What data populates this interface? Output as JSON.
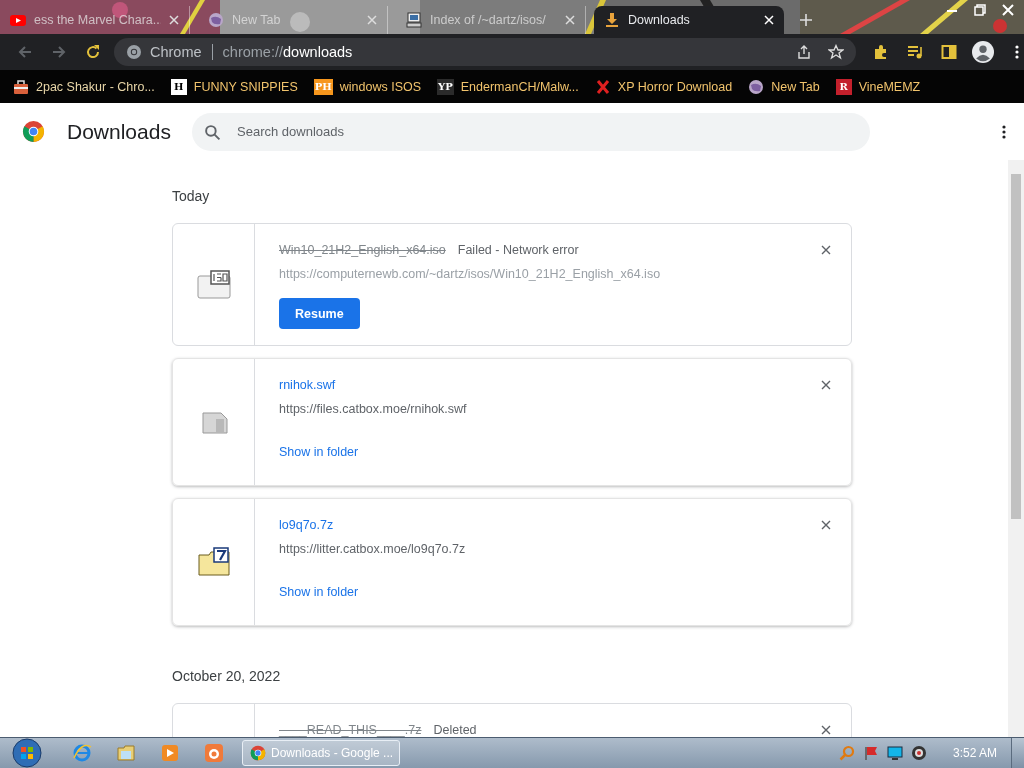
{
  "tabs": [
    {
      "title": "ess the Marvel Chara...",
      "selected": false
    },
    {
      "title": "New Tab",
      "selected": false
    },
    {
      "title": "Index of /~dartz/isos/",
      "selected": false
    },
    {
      "title": "Downloads",
      "selected": true
    }
  ],
  "address": {
    "site_label": "Chrome",
    "url_prefix": "chrome://",
    "url_path": "downloads"
  },
  "bookmarks": [
    {
      "label": "2pac Shakur - Chro...",
      "icon": {
        "kind": "bag"
      }
    },
    {
      "label": "FUNNY SNIPPIES",
      "icon": {
        "kind": "letter",
        "text": "H",
        "color": "#ffffff"
      }
    },
    {
      "label": "windows ISOS",
      "icon": {
        "kind": "letter",
        "text": "PH",
        "color": "#f7971d"
      }
    },
    {
      "label": "EndermanCH/Malw...",
      "icon": {
        "kind": "letter",
        "text": "YP",
        "color": "#2b2b2b"
      }
    },
    {
      "label": "XP Horror Download",
      "icon": {
        "kind": "cross"
      }
    },
    {
      "label": "New Tab",
      "icon": {
        "kind": "globe"
      }
    },
    {
      "label": "VineMEMZ",
      "icon": {
        "kind": "letter",
        "text": "R",
        "color": "#c4202c"
      }
    }
  ],
  "page": {
    "title": "Downloads",
    "search": {
      "placeholder": "Search downloads"
    }
  },
  "groups": [
    {
      "date": "Today",
      "items": [
        {
          "kind": "failed",
          "name": "Win10_21H2_English_x64.iso",
          "status": "Failed - Network error",
          "url": "https://computernewb.com/~dartz/isos/Win10_21H2_English_x64.iso",
          "action": "Resume"
        },
        {
          "kind": "complete",
          "name": "rnihok.swf",
          "url": "https://files.catbox.moe/rnihok.swf",
          "action": "Show in folder"
        },
        {
          "kind": "complete",
          "name": "lo9q7o.7z",
          "url": "https://litter.catbox.moe/lo9q7o.7z",
          "action": "Show in folder"
        }
      ]
    },
    {
      "date": "October 20, 2022",
      "items": [
        {
          "kind": "deleted",
          "name": "____READ_THIS____.7z",
          "status": "Deleted"
        }
      ]
    }
  ],
  "taskbar": {
    "window_button": "Downloads - Google ...",
    "clock": "3:52 AM"
  }
}
